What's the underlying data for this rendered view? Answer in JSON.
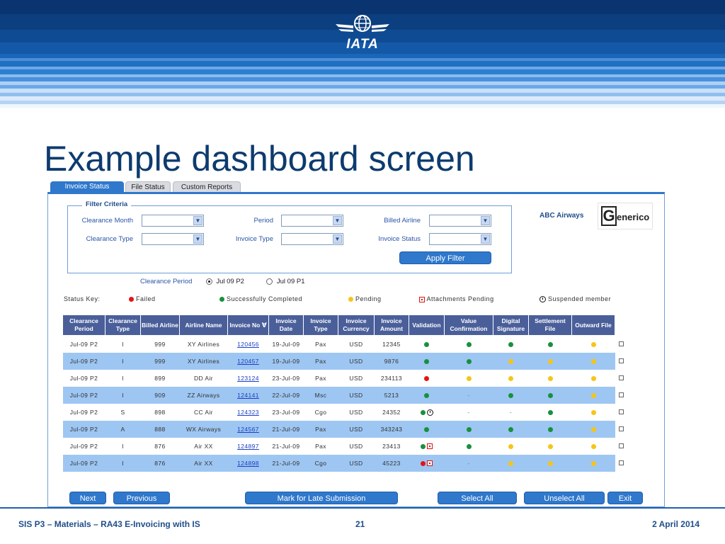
{
  "header": {
    "logo_text": "IATA"
  },
  "slide": {
    "title": "Example dashboard screen"
  },
  "tabs": [
    {
      "label": "Invoice Status",
      "active": true
    },
    {
      "label": "File Status",
      "active": false
    },
    {
      "label": "Custom Reports",
      "active": false
    }
  ],
  "filter": {
    "legend": "Filter Criteria",
    "clearance_month": "Clearance Month",
    "period": "Period",
    "billed_airline": "Billed Airline",
    "clearance_type": "Clearance Type",
    "invoice_type": "Invoice Type",
    "invoice_status": "Invoice Status",
    "apply_button": "Apply Filter"
  },
  "company": {
    "name": "ABC Airways",
    "logo_initial": "G",
    "logo_rest": "enerico"
  },
  "clearance_period": {
    "label": "Clearance Period",
    "option1": "Jul 09 P2",
    "option2": "Jul 09 P1",
    "selected": "Jul 09 P2"
  },
  "status_key": {
    "label": "Status Key:",
    "failed": "Failed",
    "success": "Successfully Completed",
    "pending": "Pending",
    "attachments": "Attachments Pending",
    "suspended": "Suspended member"
  },
  "table": {
    "headers": [
      "Clearance Period",
      "Clearance Type",
      "Billed Airline",
      "Airline Name",
      "Invoice No",
      "Invoice Date",
      "Invoice Type",
      "Invoice Currency",
      "Invoice Amount",
      "Validation",
      "Value Confirmation",
      "Digital Signature",
      "Settlement File",
      "Outward File"
    ],
    "rows": [
      {
        "period": "Jul-09 P2",
        "type": "I",
        "billed": "999",
        "name": "XY Airlines",
        "invoice_no": "120456",
        "date": "19-Jul-09",
        "inv_type": "Pax",
        "currency": "USD",
        "amount": "12345",
        "validation": [
          "green"
        ],
        "value_conf": "green",
        "digital_sig": "green",
        "settlement": "green",
        "outward": "yellow"
      },
      {
        "period": "Jul-09 P2",
        "type": "I",
        "billed": "999",
        "name": "XY Airlines",
        "invoice_no": "120457",
        "date": "19-Jul-09",
        "inv_type": "Pax",
        "currency": "USD",
        "amount": "9876",
        "validation": [
          "green"
        ],
        "value_conf": "green",
        "digital_sig": "yellow",
        "settlement": "yellow",
        "outward": "yellow"
      },
      {
        "period": "Jul-09 P2",
        "type": "I",
        "billed": "899",
        "name": "DD Air",
        "invoice_no": "123124",
        "date": "23-Jul-09",
        "inv_type": "Pax",
        "currency": "USD",
        "amount": "234113",
        "validation": [
          "red"
        ],
        "value_conf": "yellow",
        "digital_sig": "yellow",
        "settlement": "yellow",
        "outward": "yellow"
      },
      {
        "period": "Jul-09 P2",
        "type": "I",
        "billed": "909",
        "name": "ZZ Airways",
        "invoice_no": "124141",
        "date": "22-Jul-09",
        "inv_type": "Msc",
        "currency": "USD",
        "amount": "5213",
        "validation": [
          "green"
        ],
        "value_conf": "-",
        "digital_sig": "green",
        "settlement": "green",
        "outward": "yellow"
      },
      {
        "period": "Jul-09 P2",
        "type": "S",
        "billed": "898",
        "name": "CC Air",
        "invoice_no": "124323",
        "date": "23-Jul-09",
        "inv_type": "Cgo",
        "currency": "USD",
        "amount": "24352",
        "validation": [
          "green",
          "suspended"
        ],
        "value_conf": "-",
        "digital_sig": "-",
        "settlement": "green",
        "outward": "yellow"
      },
      {
        "period": "Jul-09 P2",
        "type": "A",
        "billed": "888",
        "name": "WX Airways",
        "invoice_no": "124567",
        "date": "21-Jul-09",
        "inv_type": "Pax",
        "currency": "USD",
        "amount": "343243",
        "validation": [
          "green"
        ],
        "value_conf": "green",
        "digital_sig": "green",
        "settlement": "green",
        "outward": "yellow"
      },
      {
        "period": "Jul-09 P2",
        "type": "I",
        "billed": "876",
        "name": "Air XX",
        "invoice_no": "124897",
        "date": "21-Jul-09",
        "inv_type": "Pax",
        "currency": "USD",
        "amount": "23413",
        "validation": [
          "green",
          "attachment"
        ],
        "value_conf": "green",
        "digital_sig": "yellow",
        "settlement": "yellow",
        "outward": "yellow"
      },
      {
        "period": "Jul-09 P2",
        "type": "I",
        "billed": "876",
        "name": "Air XX",
        "invoice_no": "124898",
        "date": "21-Jul-09",
        "inv_type": "Cgo",
        "currency": "USD",
        "amount": "45223",
        "validation": [
          "red",
          "attachment"
        ],
        "value_conf": "-",
        "digital_sig": "yellow",
        "settlement": "yellow",
        "outward": "yellow"
      }
    ]
  },
  "buttons": {
    "next": "Next",
    "previous": "Previous",
    "late": "Mark for Late Submission",
    "select_all": "Select All",
    "unselect_all": "Unselect All",
    "exit": "Exit"
  },
  "footer": {
    "left": "SIS P3 – Materials – RA43 E-Invoicing with IS",
    "page": "21",
    "date": "2 April 2014"
  },
  "colors": {
    "banner": "#0b3d7a",
    "accent": "#2f78cc",
    "table_header": "#4a5f9a",
    "row_alt": "#9ec6f2",
    "status_green": "#17913c",
    "status_red": "#e31414",
    "status_yellow": "#f5c518"
  }
}
